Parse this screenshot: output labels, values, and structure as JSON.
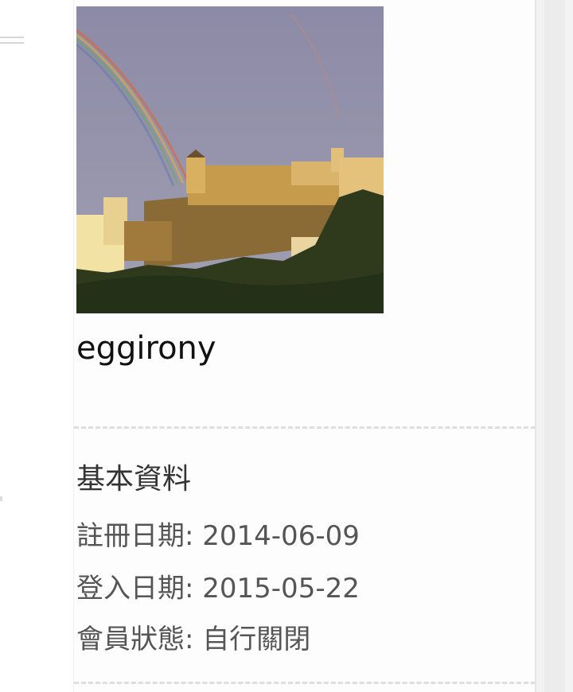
{
  "profile": {
    "username": "eggirony",
    "avatar_alt": "castle-photo-with-rainbow"
  },
  "basic_info": {
    "title": "基本資料",
    "rows": [
      {
        "label": "註冊日期",
        "sep": ": ",
        "value": "2014-06-09"
      },
      {
        "label": "登入日期",
        "sep": ": ",
        "value": "2015-05-22"
      },
      {
        "label": "會員狀態",
        "sep": ": ",
        "value": "自行關閉"
      }
    ]
  },
  "colors": {
    "sky": "#8f8fa8",
    "castle": "#c99a45",
    "trees": "#2f3a1c",
    "divider": "#dedede"
  }
}
